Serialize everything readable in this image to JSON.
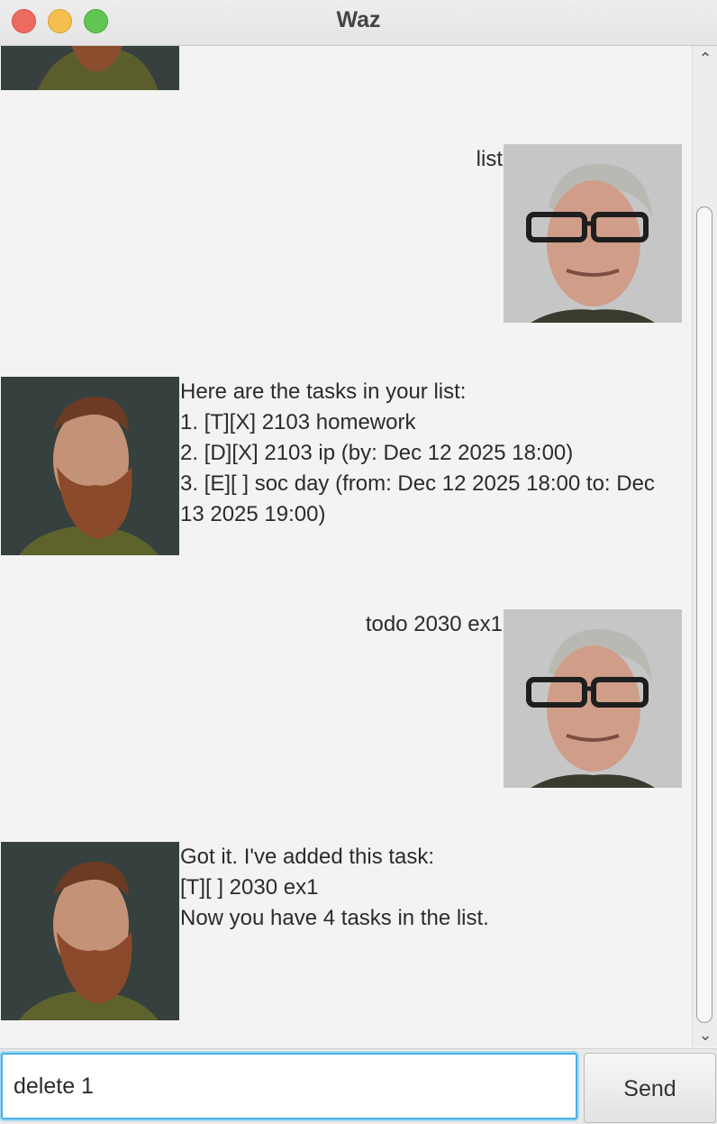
{
  "window": {
    "title": "Waz"
  },
  "conversation": [
    {
      "speaker": "user",
      "lines": [
        "list"
      ]
    },
    {
      "speaker": "bot",
      "lines": [
        "Here are the tasks in your list:",
        "1. [T][X] 2103 homework",
        "2. [D][X] 2103 ip (by: Dec 12 2025 18:00)",
        "3. [E][ ] soc day (from: Dec 12 2025 18:00 to: Dec",
        "13 2025 19:00)"
      ]
    },
    {
      "speaker": "user",
      "lines": [
        "todo 2030 ex1"
      ]
    },
    {
      "speaker": "bot",
      "lines": [
        "Got it. I've added this task:",
        "[T][ ] 2030 ex1",
        "Now you have 4 tasks in the list."
      ]
    }
  ],
  "input": {
    "value": "delete 1"
  },
  "send_button": {
    "label": "Send"
  },
  "icons": {
    "scroll_up": "chevron-up-icon",
    "scroll_down": "chevron-down-icon"
  },
  "colors": {
    "accent_focus": "#46b0e6",
    "close": "#ed6a5e",
    "minimize": "#f5bf4f",
    "maximize": "#61c554"
  }
}
